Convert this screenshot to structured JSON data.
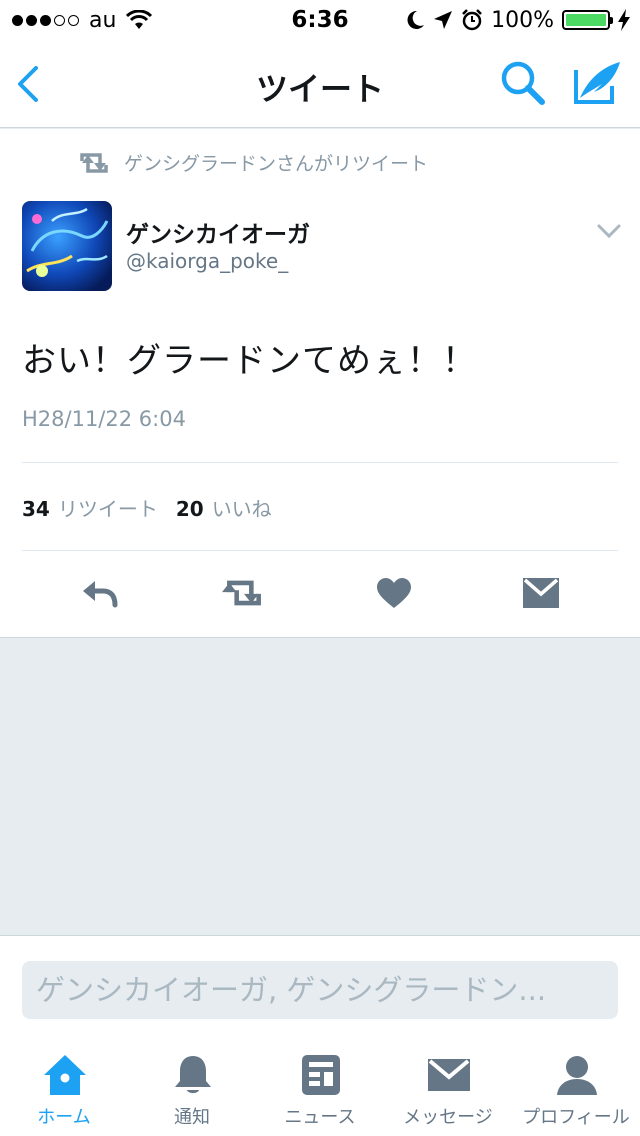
{
  "status_bar": {
    "carrier": "au",
    "time": "6:36",
    "battery": "100%",
    "battery_level": 1.0
  },
  "nav": {
    "title": "ツイート",
    "back_icon": "chevron-left-icon",
    "search_icon": "search-icon",
    "compose_icon": "compose-icon"
  },
  "tweet": {
    "retweet_context": "ゲンシグラードンさんがリツイート",
    "author_name": "ゲンシカイオーガ",
    "author_handle": "@kaiorga_poke_",
    "text": "おい！グラードンてめぇ！！",
    "timestamp": "H28/11/22 6:04",
    "retweet_count": "34",
    "retweet_label": "リツイート",
    "like_count": "20",
    "like_label": "いいね"
  },
  "reply": {
    "placeholder": "ゲンシカイオーガ, ゲンシグラードン..."
  },
  "tabs": [
    {
      "label": "ホーム",
      "icon": "home-icon",
      "active": true
    },
    {
      "label": "通知",
      "icon": "bell-icon",
      "active": false
    },
    {
      "label": "ニュース",
      "icon": "news-icon",
      "active": false
    },
    {
      "label": "メッセージ",
      "icon": "envelope-icon",
      "active": false
    },
    {
      "label": "プロフィール",
      "icon": "person-icon",
      "active": false
    }
  ],
  "colors": {
    "accent": "#1da1f2",
    "icon_gray": "#657786",
    "muted_text": "#8899a6",
    "background": "#e6ecf0",
    "battery_green": "#4cd964"
  }
}
